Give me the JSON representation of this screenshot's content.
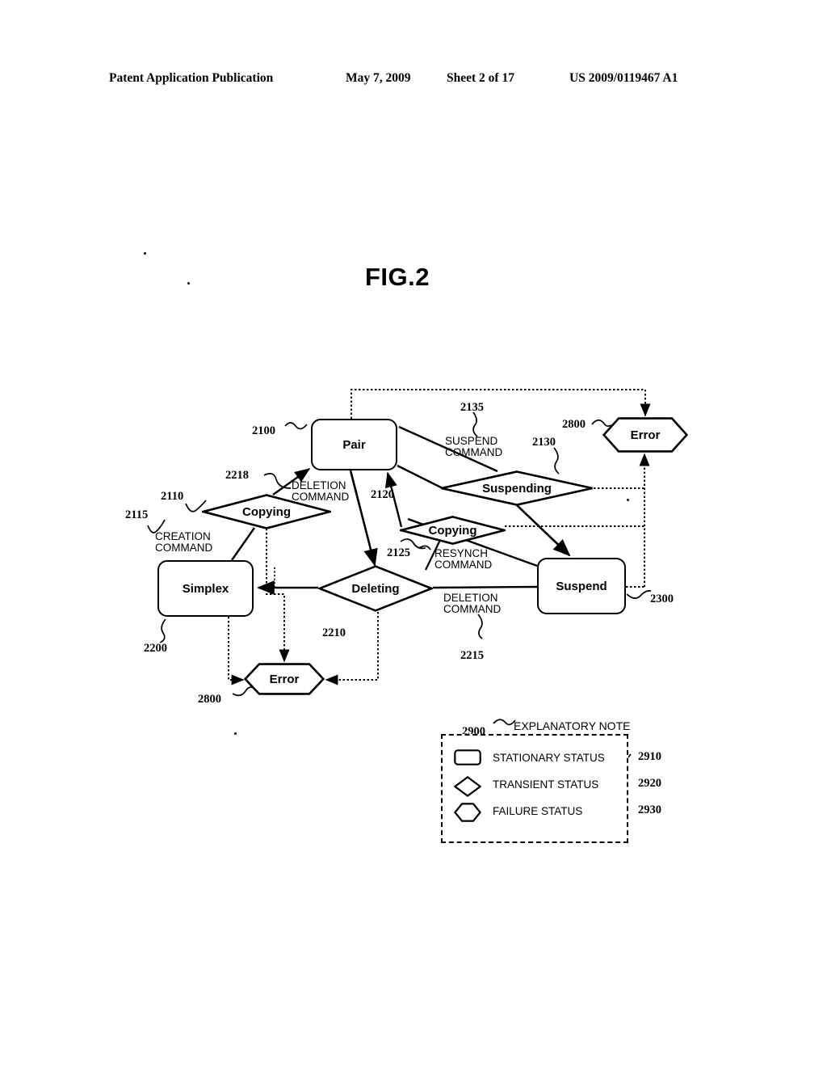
{
  "header": {
    "publication": "Patent Application Publication",
    "date": "May 7, 2009",
    "sheet": "Sheet 2 of 17",
    "docnum": "US 2009/0119467 A1"
  },
  "figure": {
    "title": "FIG.2",
    "type": "state-transition-diagram"
  },
  "nodes": [
    {
      "id": "pair",
      "label": "Pair",
      "shape": "stationary",
      "ref": "2100"
    },
    {
      "id": "copying_a",
      "label": "Copying",
      "shape": "transient",
      "ref": "2110"
    },
    {
      "id": "copying_b",
      "label": "Copying",
      "shape": "transient",
      "ref": "2120"
    },
    {
      "id": "suspending",
      "label": "Suspending",
      "shape": "transient",
      "ref": "2130"
    },
    {
      "id": "deleting",
      "label": "Deleting",
      "shape": "transient",
      "ref": "2210"
    },
    {
      "id": "simplex",
      "label": "Simplex",
      "shape": "stationary",
      "ref": "2200"
    },
    {
      "id": "suspend",
      "label": "Suspend",
      "shape": "stationary",
      "ref": "2300"
    },
    {
      "id": "error_top",
      "label": "Error",
      "shape": "failure",
      "ref": "2800"
    },
    {
      "id": "error_bottom",
      "label": "Error",
      "shape": "failure",
      "ref": "2800"
    }
  ],
  "commands": [
    {
      "id": "creation",
      "line1": "CREATION",
      "line2": "COMMAND",
      "ref": "2115"
    },
    {
      "id": "deletion_a",
      "line1": "DELETION",
      "line2": "COMMAND",
      "ref": "2218"
    },
    {
      "id": "suspend_cmd",
      "line1": "SUSPEND",
      "line2": "COMMAND",
      "ref": "2135"
    },
    {
      "id": "resynch",
      "line1": "RESYNCH",
      "line2": "COMMAND",
      "ref": "2125"
    },
    {
      "id": "deletion_b",
      "line1": "DELETION",
      "line2": "COMMAND",
      "ref": "2215"
    }
  ],
  "legend": {
    "title": "EXPLANATORY NOTE",
    "ref": "2900",
    "rows": [
      {
        "icon": "rounded-rectangle-icon",
        "label": "STATIONARY STATUS",
        "ref": "2910"
      },
      {
        "icon": "diamond-icon",
        "label": "TRANSIENT STATUS",
        "ref": "2920"
      },
      {
        "icon": "hexagon-icon",
        "label": "FAILURE STATUS",
        "ref": "2930"
      }
    ]
  },
  "colors": {
    "ink": "#000000",
    "paper": "#ffffff"
  }
}
